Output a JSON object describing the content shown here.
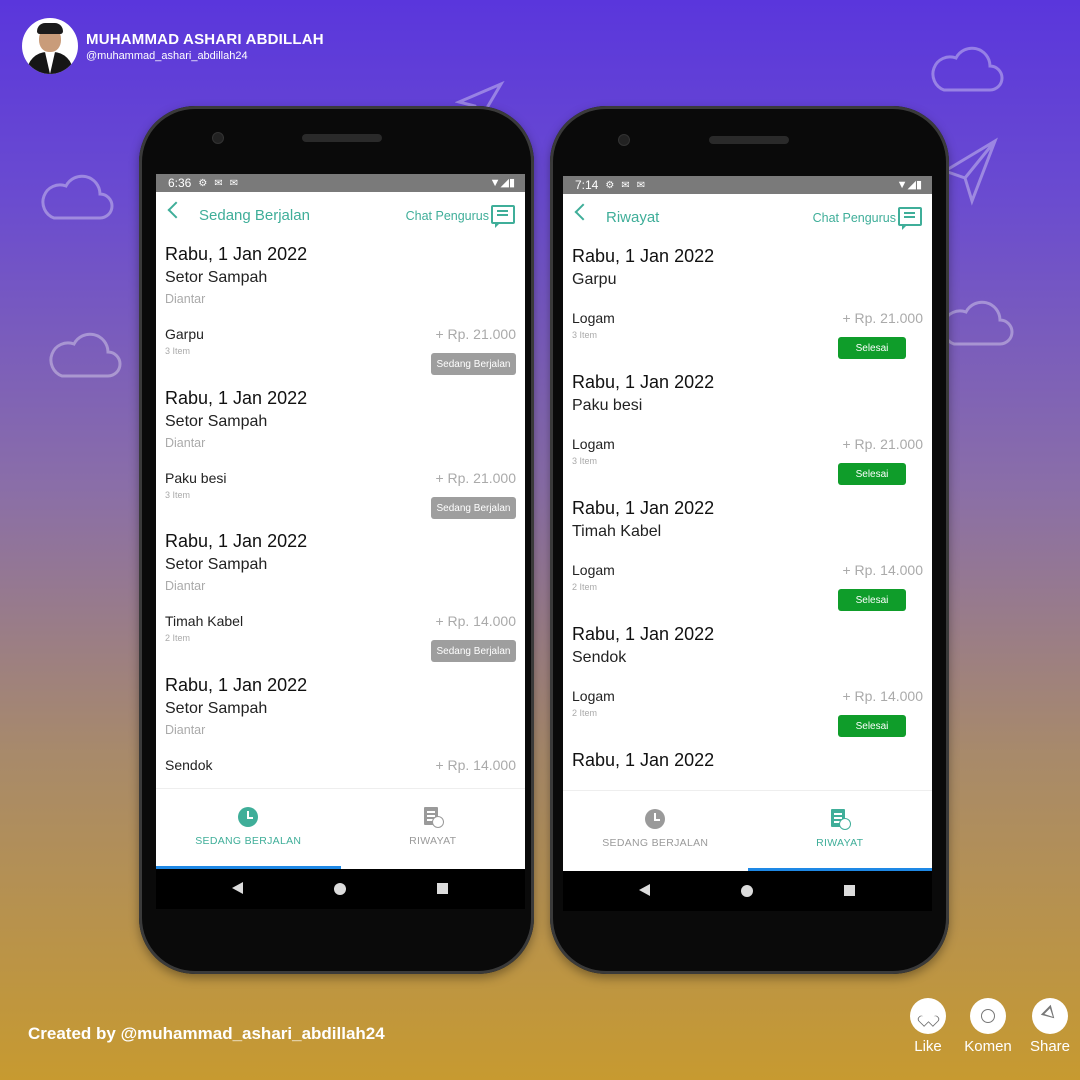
{
  "profile": {
    "name": "MUHAMMAD ASHARI ABDILLAH",
    "handle": "@muhammad_ashari_abdillah24"
  },
  "colors": {
    "accent": "#3fae99",
    "badge_gray": "#9e9e9e",
    "badge_green": "#0f9d2a",
    "tab_indicator": "#1e88e5",
    "icon_inactive": "#9a9a9a"
  },
  "phone_left": {
    "status": {
      "time": "6:36"
    },
    "appbar": {
      "title": "Sedang Berjalan",
      "chat_label": "Chat Pengurus",
      "chat_icon": "chat-icon"
    },
    "groups": [
      {
        "date": "Rabu, 1 Jan 2022",
        "type": "Setor Sampah",
        "status_text": "Diantar",
        "item": "Garpu",
        "count": "3 Item",
        "price": "+ Rp. 21.000",
        "badge": "Sedang Berjalan"
      },
      {
        "date": "Rabu, 1 Jan 2022",
        "type": "Setor Sampah",
        "status_text": "Diantar",
        "item": "Paku besi",
        "count": "3 Item",
        "price": "+ Rp. 21.000",
        "badge": "Sedang Berjalan"
      },
      {
        "date": "Rabu, 1 Jan 2022",
        "type": "Setor Sampah",
        "status_text": "Diantar",
        "item": "Timah Kabel",
        "count": "2 Item",
        "price": "+ Rp. 14.000",
        "badge": "Sedang Berjalan"
      },
      {
        "date": "Rabu, 1 Jan 2022",
        "type": "Setor Sampah",
        "status_text": "Diantar",
        "item": "Sendok",
        "price": "+ Rp. 14.000"
      }
    ],
    "tabs": [
      {
        "label": "SEDANG BERJALAN",
        "icon": "clock-icon",
        "active": true
      },
      {
        "label": "RIWAYAT",
        "icon": "history-doc-icon",
        "active": false
      }
    ]
  },
  "phone_right": {
    "status": {
      "time": "7:14"
    },
    "appbar": {
      "title": "Riwayat",
      "chat_label": "Chat Pengurus",
      "chat_icon": "chat-icon"
    },
    "groups": [
      {
        "date": "Rabu, 1 Jan 2022",
        "type": "Garpu",
        "item": "Logam",
        "count": "3 Item",
        "price": "+ Rp. 21.000",
        "badge": "Selesai"
      },
      {
        "date": "Rabu, 1 Jan 2022",
        "type": "Paku besi",
        "item": "Logam",
        "count": "3 Item",
        "price": "+ Rp. 21.000",
        "badge": "Selesai"
      },
      {
        "date": "Rabu, 1 Jan 2022",
        "type": "Timah Kabel",
        "item": "Logam",
        "count": "2 Item",
        "price": "+ Rp. 14.000",
        "badge": "Selesai"
      },
      {
        "date": "Rabu, 1 Jan 2022",
        "type": "Sendok",
        "item": "Logam",
        "count": "2 Item",
        "price": "+ Rp. 14.000",
        "badge": "Selesai"
      },
      {
        "date": "Rabu, 1 Jan 2022"
      }
    ],
    "tabs": [
      {
        "label": "SEDANG BERJALAN",
        "icon": "clock-icon",
        "active": false
      },
      {
        "label": "RIWAYAT",
        "icon": "history-doc-icon",
        "active": true
      }
    ]
  },
  "footer": {
    "credit": "Created by @muhammad_ashari_abdillah24",
    "actions": [
      {
        "label": "Like",
        "icon": "heart-icon"
      },
      {
        "label": "Komen",
        "icon": "comment-icon"
      },
      {
        "label": "Share",
        "icon": "send-icon"
      }
    ]
  }
}
